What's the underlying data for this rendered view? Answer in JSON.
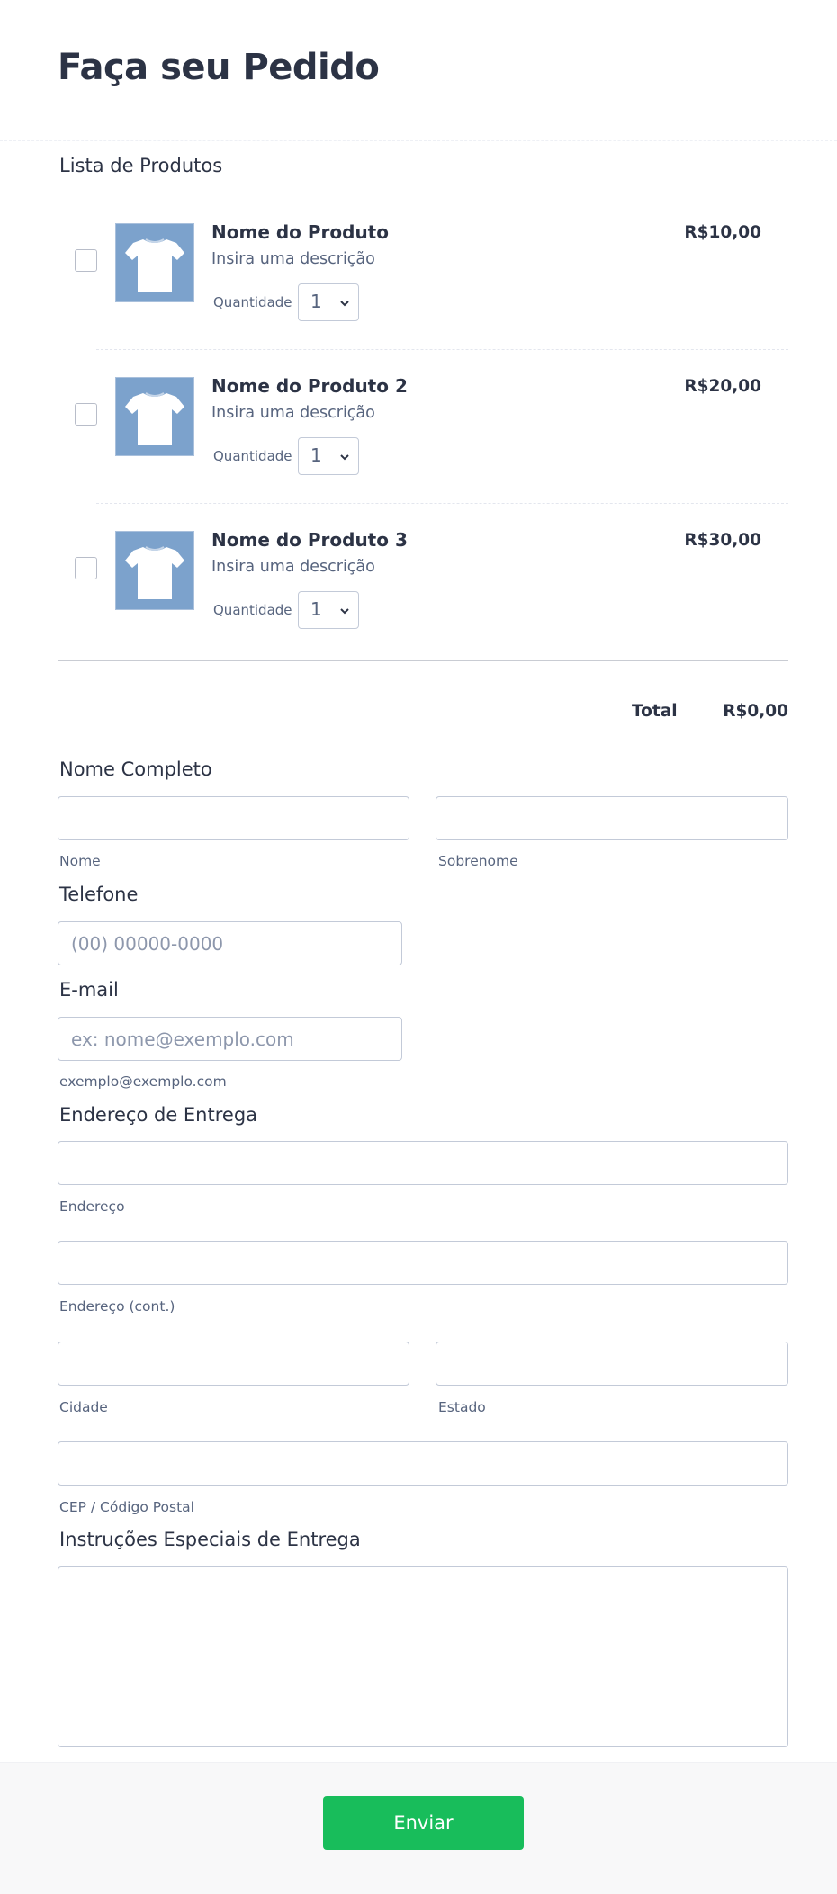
{
  "form": {
    "title": "Faça seu Pedido",
    "products_label": "Lista de Produtos"
  },
  "products": [
    {
      "name": "Nome do Produto",
      "description": "Insira uma descrição",
      "price": "R$10,00",
      "quantity_label": "Quantidade",
      "quantity": "1",
      "checked": false
    },
    {
      "name": "Nome do Produto 2",
      "description": "Insira uma descrição",
      "price": "R$20,00",
      "quantity_label": "Quantidade",
      "quantity": "1",
      "checked": false
    },
    {
      "name": "Nome do Produto 3",
      "description": "Insira uma descrição",
      "price": "R$30,00",
      "quantity_label": "Quantidade",
      "quantity": "1",
      "checked": false
    }
  ],
  "total": {
    "label": "Total",
    "value": "R$0,00"
  },
  "full_name": {
    "label": "Nome Completo",
    "first": {
      "value": "",
      "sublabel": "Nome"
    },
    "last": {
      "value": "",
      "sublabel": "Sobrenome"
    }
  },
  "phone": {
    "label": "Telefone",
    "value": "",
    "placeholder": "(00) 00000-0000"
  },
  "email": {
    "label": "E-mail",
    "value": "",
    "placeholder": "ex: nome@exemplo.com",
    "sublabel": "exemplo@exemplo.com"
  },
  "address": {
    "label": "Endereço de Entrega",
    "line1": {
      "value": "",
      "sublabel": "Endereço"
    },
    "line2": {
      "value": "",
      "sublabel": "Endereço (cont.)"
    },
    "city": {
      "value": "",
      "sublabel": "Cidade"
    },
    "state": {
      "value": "",
      "sublabel": "Estado"
    },
    "zip": {
      "value": "",
      "sublabel": "CEP / Código Postal"
    }
  },
  "instructions": {
    "label": "Instruções Especiais de Entrega",
    "value": ""
  },
  "submit": {
    "label": "Enviar"
  },
  "colors": {
    "accent": "#18bd5b",
    "thumbnail": "#7ca2cc",
    "text": "#2c3345",
    "muted": "#57647e"
  },
  "icons": {
    "product_thumbnail": "tshirt-icon",
    "quantity_dropdown": "chevron-down-icon"
  }
}
